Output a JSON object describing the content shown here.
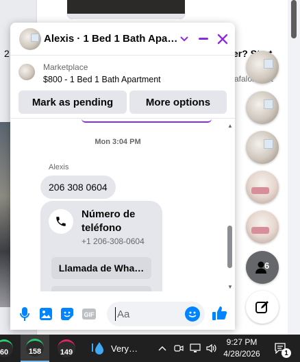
{
  "background": {
    "left_fragment": "2",
    "right_text": "er? Start",
    "right_sub": "afalonl…st"
  },
  "chat": {
    "title": "Alexis · 1 Bed 1 Bath Apartment",
    "listing": {
      "source": "Marketplace",
      "price_title": "$800 - 1 Bed 1 Bath Apartment"
    },
    "buttons": {
      "mark_pending": "Mark as pending",
      "more_options": "More options"
    },
    "timestamp": "Mon 3:04 PM",
    "sender": "Alexis",
    "message": "206 308 0604",
    "phone_card": {
      "title": "Número de teléfono",
      "number": "+1 206-308-0604",
      "action": "Llamada de Wha…"
    },
    "composer": {
      "placeholder": "Aa"
    }
  },
  "chat_heads": {
    "group_count": "6"
  },
  "taskbar": {
    "gauges": [
      "60",
      "158",
      "149"
    ],
    "weather": "Very…",
    "time": "9:27 PM",
    "date": "4/28/2026",
    "notification_count": "1"
  },
  "colors": {
    "accent_purple": "#8a2be2",
    "messenger_blue": "#0084ff",
    "bubble_gray": "#e4e6eb"
  }
}
